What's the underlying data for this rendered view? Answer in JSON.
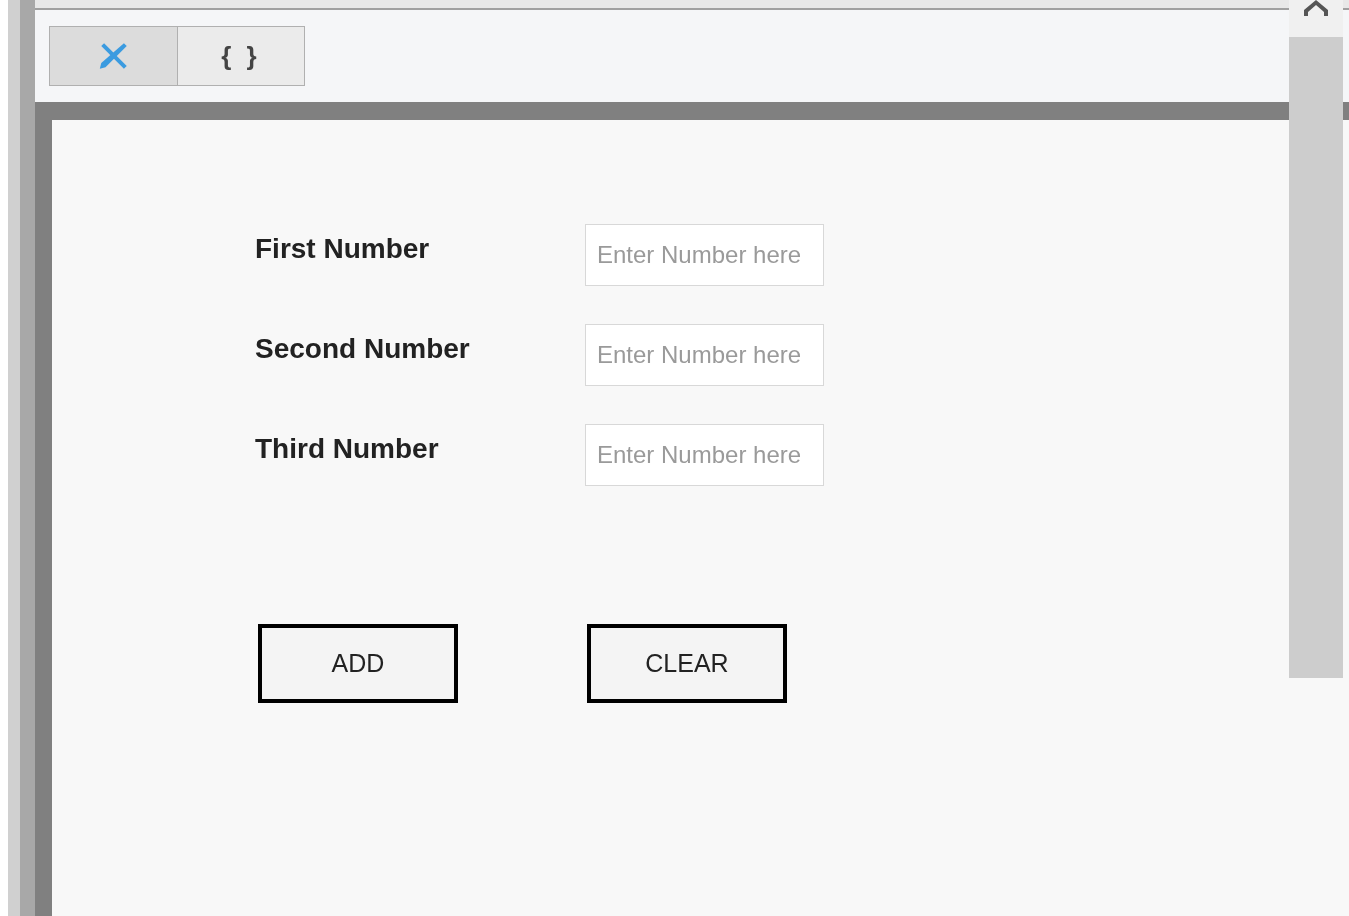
{
  "toolbar": {
    "tabs": [
      {
        "kind": "icon",
        "selected": true
      },
      {
        "kind": "text",
        "label": "{ }",
        "selected": false
      }
    ]
  },
  "form": {
    "fields": [
      {
        "label": "First Number",
        "placeholder": "Enter Number here"
      },
      {
        "label": "Second Number",
        "placeholder": "Enter Number here"
      },
      {
        "label": "Third Number",
        "placeholder": "Enter Number here"
      }
    ],
    "buttons": [
      "ADD",
      "CLEAR"
    ]
  }
}
